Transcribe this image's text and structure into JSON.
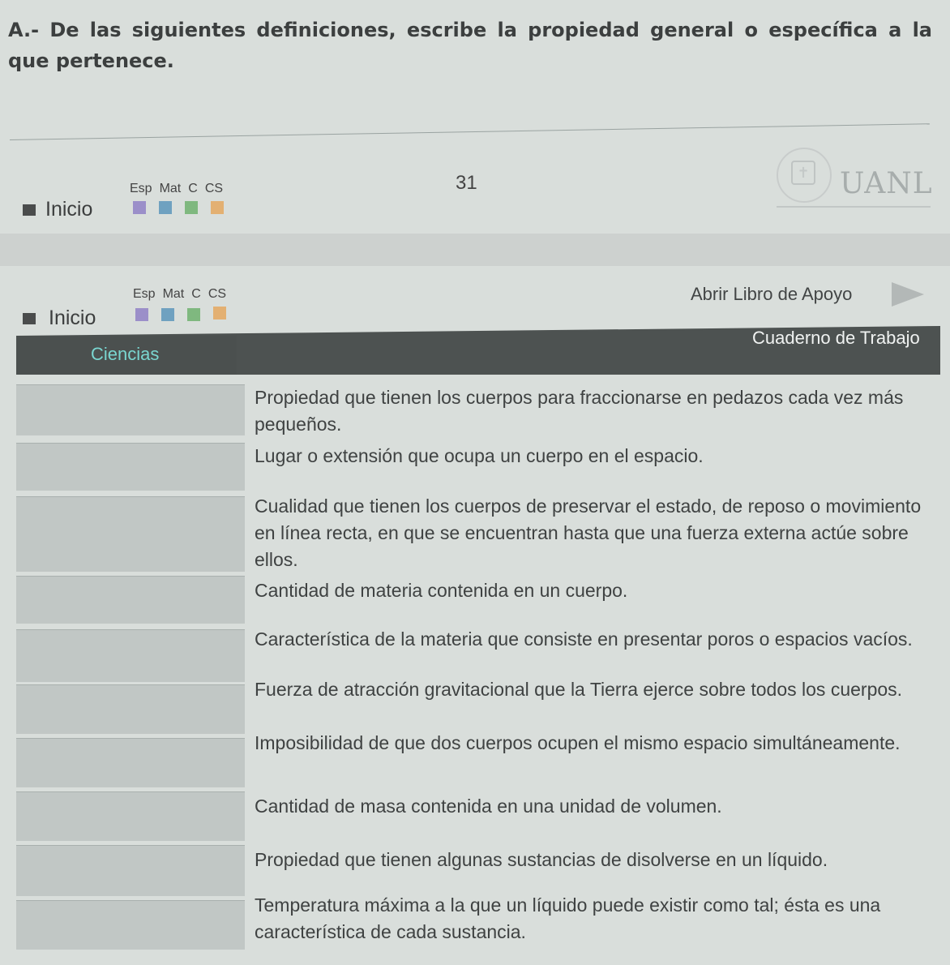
{
  "instruction": "A.- De las siguientes definiciones, escribe la propiedad general o específica a la que pertenece.",
  "top_nav": {
    "inicio_label": "Inicio",
    "subjects": [
      "Esp",
      "Mat",
      "C",
      "CS"
    ],
    "page_number": "31",
    "logo_text": "UANL"
  },
  "second_nav": {
    "inicio_label": "Inicio",
    "subjects": [
      "Esp",
      "Mat",
      "C",
      "CS"
    ],
    "open_book_label": "Abrir Libro de Apoyo"
  },
  "header": {
    "section_tab": "Ciencias",
    "workbook_label": "Cuaderno de Trabajo"
  },
  "definitions": [
    {
      "text": "Propiedad que tienen los cuerpos para fraccionarse en pedazos cada vez más pequeños.",
      "answer": ""
    },
    {
      "text": "Lugar o extensión que ocupa un cuerpo en el espacio.",
      "answer": ""
    },
    {
      "text": "Cualidad que tienen los cuerpos de preservar el estado, de reposo o movimiento en línea recta, en que se encuentran hasta que una fuerza externa actúe sobre ellos.",
      "answer": ""
    },
    {
      "text": "Cantidad de materia contenida en un cuerpo.",
      "answer": ""
    },
    {
      "text": "Característica de la materia que consiste en presentar poros o espacios vacíos.",
      "answer": ""
    },
    {
      "text": "Fuerza de atracción gravitacional que la Tierra ejerce sobre todos los cuerpos.",
      "answer": ""
    },
    {
      "text": "Imposibilidad de que dos cuerpos ocupen el mismo espacio simultáneamente.",
      "answer": ""
    },
    {
      "text": "Cantidad de masa contenida en una unidad de volumen.",
      "answer": ""
    },
    {
      "text": "Propiedad que tienen algunas sustancias de disolverse en un líquido.",
      "answer": ""
    },
    {
      "text": "Temperatura máxima a la que un líquido puede existir como tal; ésta es una característica de cada sustancia.",
      "answer": ""
    }
  ]
}
